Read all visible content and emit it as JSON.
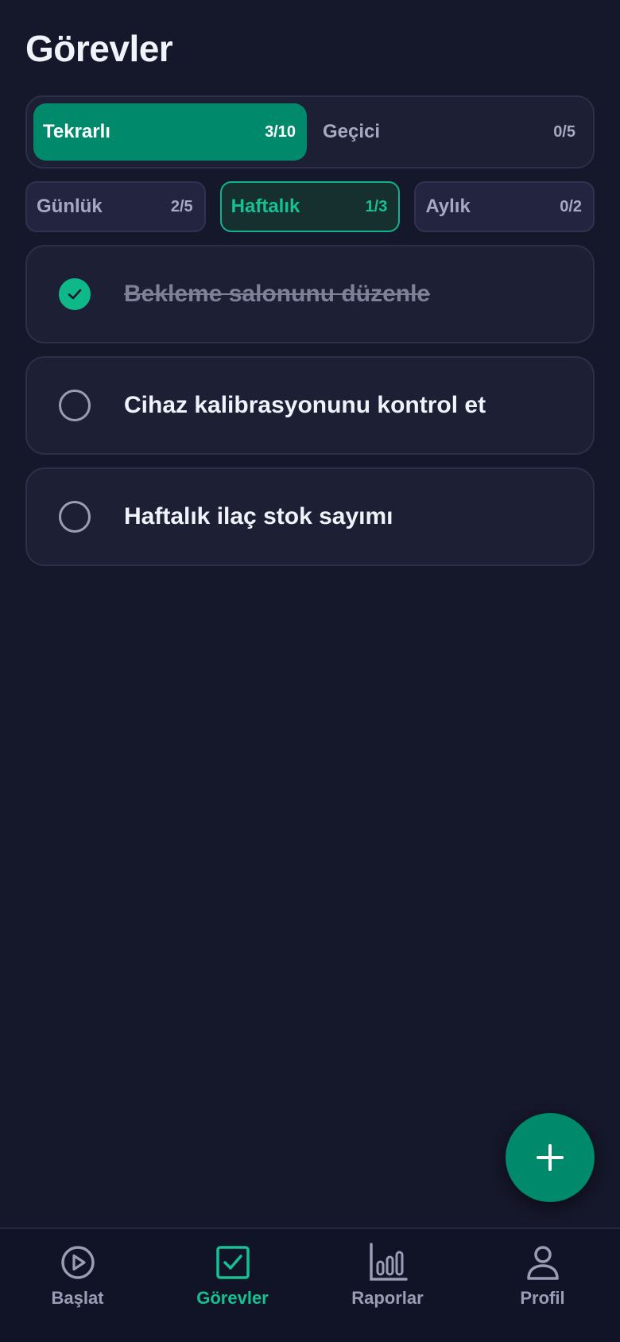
{
  "header": {
    "title": "Görevler"
  },
  "segment": {
    "items": [
      {
        "label": "Tekrarlı",
        "count": "3/10",
        "active": true
      },
      {
        "label": "Geçici",
        "count": "0/5",
        "active": false
      }
    ]
  },
  "filters": {
    "items": [
      {
        "label": "Günlük",
        "count": "2/5",
        "active": false
      },
      {
        "label": "Haftalık",
        "count": "1/3",
        "active": true
      },
      {
        "label": "Aylık",
        "count": "0/2",
        "active": false
      }
    ]
  },
  "tasks": [
    {
      "label": "Bekleme salonunu düzenle",
      "done": true
    },
    {
      "label": "Cihaz kalibrasyonunu kontrol et",
      "done": false
    },
    {
      "label": "Haftalık ilaç stok sayımı",
      "done": false
    }
  ],
  "fab": {
    "icon": "plus-icon"
  },
  "nav": {
    "items": [
      {
        "label": "Başlat",
        "icon": "play-circle-icon",
        "active": false
      },
      {
        "label": "Görevler",
        "icon": "checkbox-icon",
        "active": true
      },
      {
        "label": "Raporlar",
        "icon": "bar-chart-icon",
        "active": false
      },
      {
        "label": "Profil",
        "icon": "user-icon",
        "active": false
      }
    ]
  },
  "colors": {
    "background": "#15172a",
    "accent": "#00896a",
    "accent_text": "#15c192",
    "muted": "#9a9db5"
  }
}
